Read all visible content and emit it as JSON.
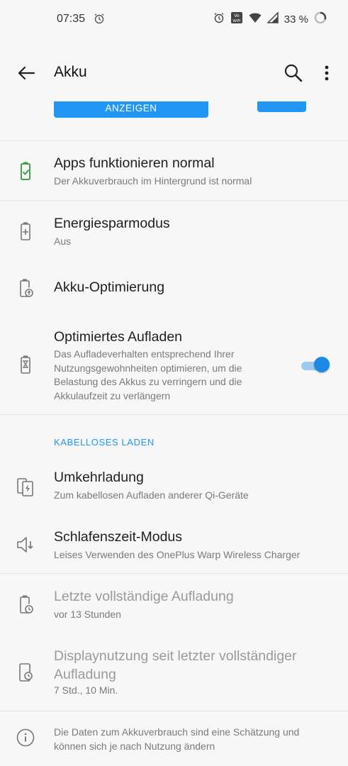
{
  "status_bar": {
    "time": "07:35",
    "battery_percent": "33 %",
    "icons": [
      "alarm-icon",
      "volte-wifi-icon",
      "wifi-icon",
      "signal-icon",
      "battery-ring-icon"
    ]
  },
  "app_bar": {
    "title": "Akku",
    "back_icon": "arrow-back-icon",
    "search_icon": "search-icon",
    "more_icon": "more-vert-icon"
  },
  "top_button": {
    "label": "ANZEIGEN"
  },
  "items": [
    {
      "title": "Apps funktionieren normal",
      "subtitle": "Der Akkuverbrauch im Hintergrund ist normal",
      "icon": "battery-ok-icon"
    },
    {
      "title": "Energiesparmodus",
      "subtitle": "Aus",
      "icon": "battery-saver-icon"
    },
    {
      "title": "Akku-Optimierung",
      "subtitle": "",
      "icon": "battery-optimize-icon"
    },
    {
      "title": "Optimiertes Aufladen",
      "subtitle": "Das Aufladeverhalten entsprechend Ihrer Nutzungsgewohnheiten optimieren, um die Belastung des Akkus zu verringern und die Akkulaufzeit zu verlängern",
      "icon": "battery-hourglass-icon",
      "toggle_on": true
    }
  ],
  "section_header": "KABELLOSES LADEN",
  "wireless_items": [
    {
      "title": "Umkehrladung",
      "subtitle": "Zum kabellosen Aufladen anderer Qi-Geräte",
      "icon": "reverse-charge-icon"
    },
    {
      "title": "Schlafenszeit-Modus",
      "subtitle": "Leises Verwenden des OnePlus Warp Wireless Charger",
      "icon": "speaker-low-icon"
    }
  ],
  "stats": [
    {
      "title": "Letzte vollständige Aufladung",
      "subtitle": "vor 13 Stunden",
      "icon": "battery-clock-icon"
    },
    {
      "title": "Displaynutzung seit letzter vollständiger Aufladung",
      "subtitle": "7 Std., 10 Min.",
      "icon": "screen-usage-icon"
    }
  ],
  "footer": {
    "text": "Die Daten zum Akkuverbrauch sind eine Schätzung und können sich je nach Nutzung ändern",
    "icon": "info-icon"
  },
  "colors": {
    "accent": "#2196f3",
    "ok_green": "#43a047",
    "background": "#f7f7f7"
  }
}
